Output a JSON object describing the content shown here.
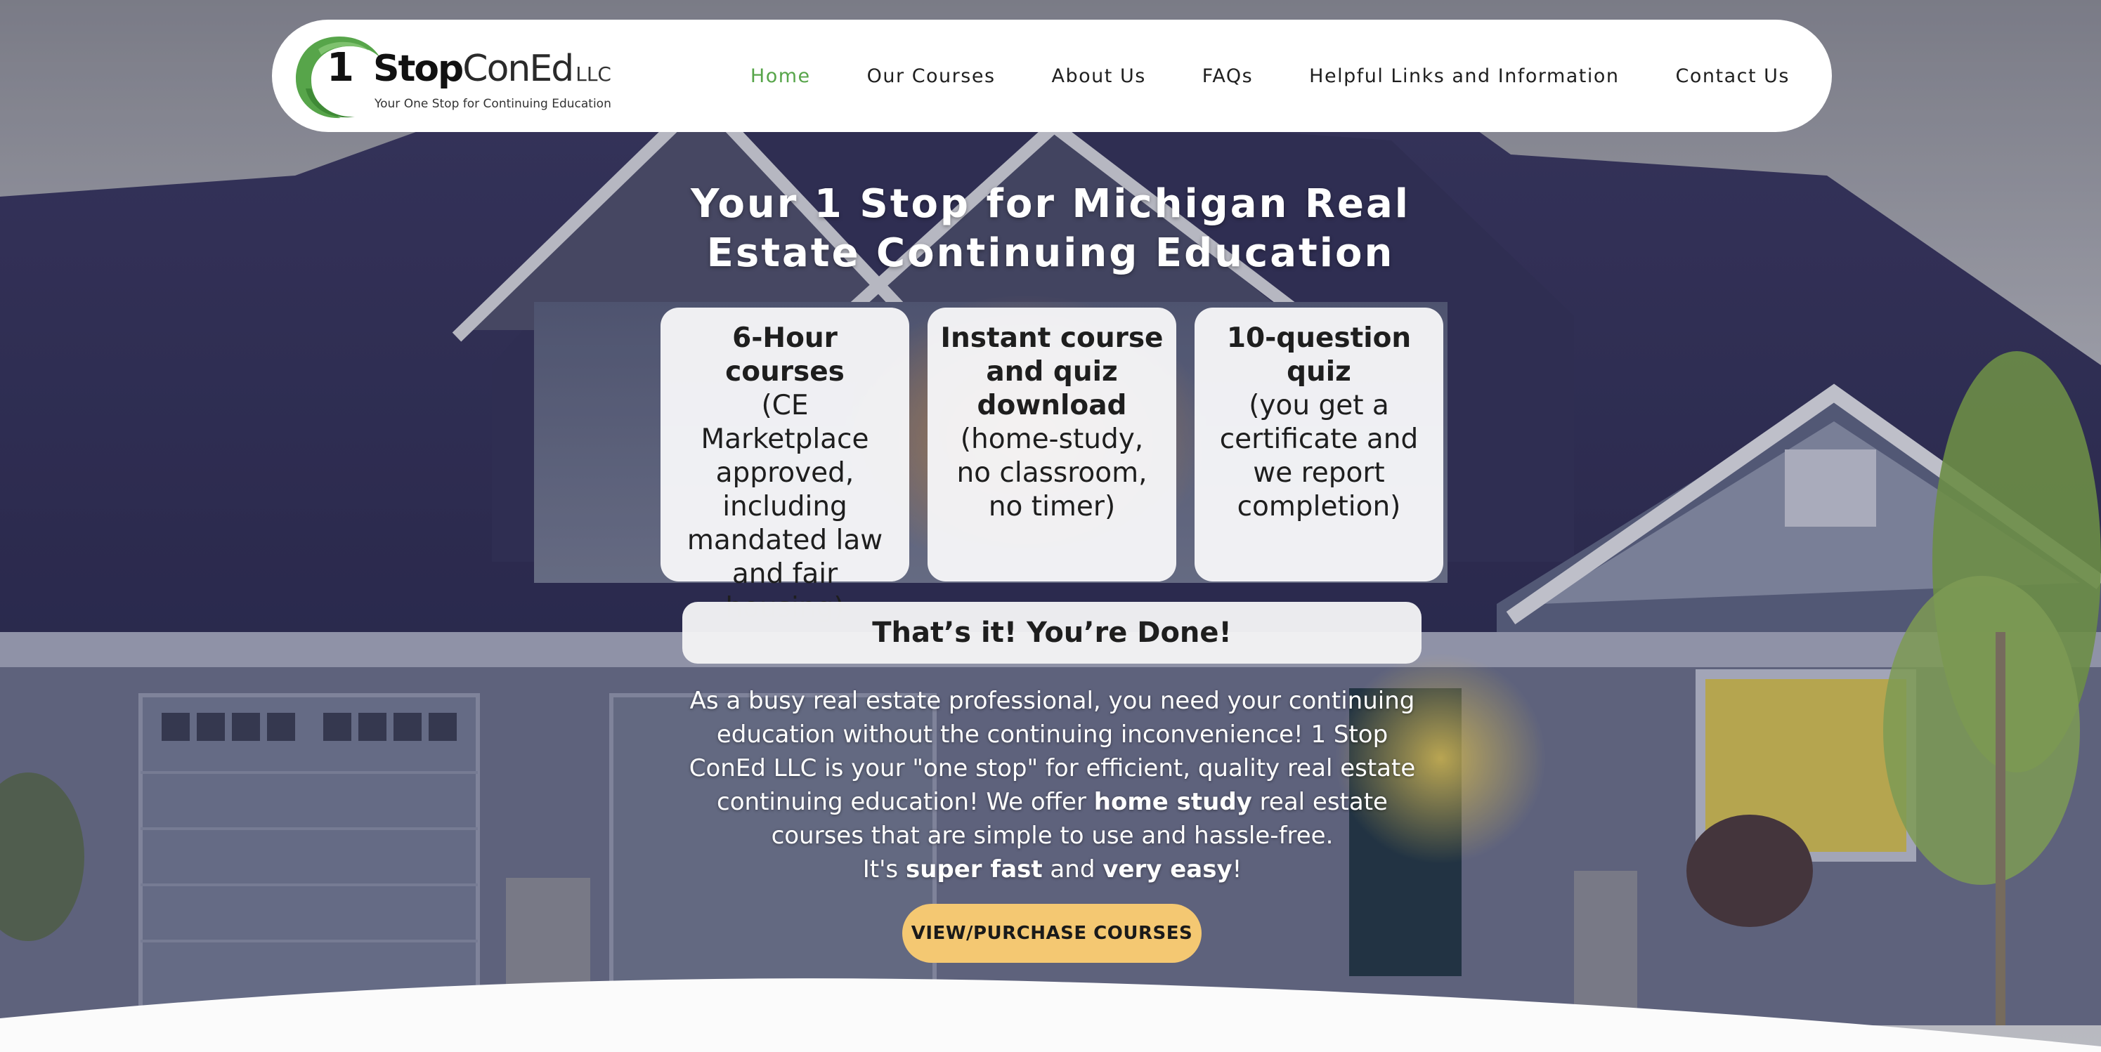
{
  "brand": {
    "logo_number": "1",
    "logo_word_bold": "Stop",
    "logo_word_light": "ConEd",
    "logo_suffix": "LLC",
    "tagline": "Your One Stop for Continuing Education",
    "logo_color": "#57a54a"
  },
  "nav": {
    "items": [
      {
        "label": "Home",
        "active": true
      },
      {
        "label": "Our Courses",
        "active": false
      },
      {
        "label": "About Us",
        "active": false
      },
      {
        "label": "FAQs",
        "active": false
      },
      {
        "label": "Helpful Links and Information",
        "active": false
      },
      {
        "label": "Contact Us",
        "active": false
      }
    ],
    "active_color": "#57a54a"
  },
  "hero": {
    "title_line1": "Your 1 Stop for Michigan Real",
    "title_line2": "Estate Continuing Education",
    "features": [
      {
        "title": "6-Hour courses",
        "body": "(CE Marketplace approved, including mandated law and fair housing)"
      },
      {
        "title": "Instant course and quiz download",
        "body": "(home-study, no classroom, no timer)"
      },
      {
        "title": "10-question quiz",
        "body": "(you get a certificate and we report completion)"
      }
    ],
    "done_text": "That’s it! You’re Done!",
    "intro": {
      "part1": "As a busy real estate professional, you need your continuing education without the continuing inconvenience! 1 Stop ConEd LLC is your \"one stop\" for efficient, quality real estate continuing education! We offer ",
      "bold1": "home study",
      "part2": " real estate courses that are simple to use and hassle-free.",
      "line2_prefix": "It's ",
      "bold2": "super fast",
      "line2_mid": " and ",
      "bold3": "very easy",
      "line2_suffix": "!"
    },
    "cta_label": "VIEW/PURCHASE COURSES",
    "cta_color": "#f4c872"
  }
}
